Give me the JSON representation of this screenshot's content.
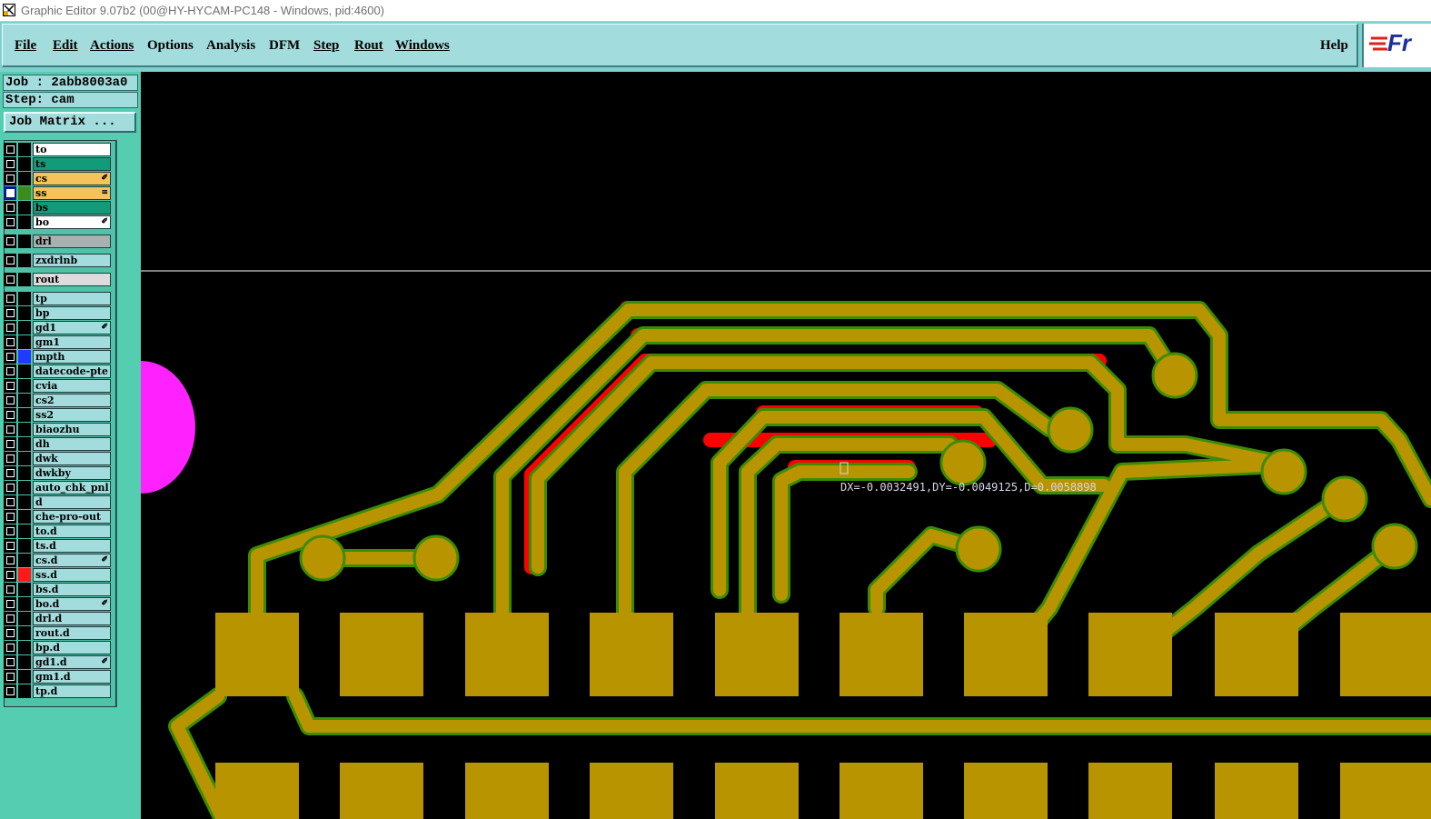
{
  "window": {
    "title": "Graphic Editor 9.07b2 (00@HY-HYCAM-PC148 - Windows, pid:4600)",
    "icon": "graphic-editor-icon"
  },
  "menu": {
    "file": "File",
    "edit": "Edit",
    "actions": "Actions",
    "options": "Options",
    "analysis": "Analysis",
    "dfm": "DFM",
    "step": "Step",
    "rout": "Rout",
    "windows": "Windows",
    "help": "Help",
    "logo": "Fr"
  },
  "panel": {
    "job_line": "Job : 2abb8003a0",
    "step_line": "Step: cam",
    "job_matrix_label": "Job Matrix ..."
  },
  "layers": [
    {
      "name": "to",
      "bg": "#ffffff",
      "mark": ""
    },
    {
      "name": "ts",
      "bg": "#139b79",
      "mark": ""
    },
    {
      "name": "cs",
      "bg": "#f6c25c",
      "mark": "✐"
    },
    {
      "name": "ss",
      "bg": "#f6c25c",
      "mark": "≡",
      "selected": true,
      "indicator": "#3b8c1a"
    },
    {
      "name": "bs",
      "bg": "#139b79",
      "mark": ""
    },
    {
      "name": "bo",
      "bg": "#ffffff",
      "mark": "✐"
    },
    {
      "name": "drl",
      "bg": "#a8b0b0",
      "mark": "",
      "gap": true
    },
    {
      "name": "zxdrlnb",
      "bg": "#a2dcdc",
      "mark": "",
      "gap": true
    },
    {
      "name": "rout",
      "bg": "#dcdcdc",
      "mark": "",
      "gap": true
    },
    {
      "name": "tp",
      "bg": "#a2dcdc",
      "mark": "",
      "gap": true
    },
    {
      "name": "bp",
      "bg": "#a2dcdc",
      "mark": ""
    },
    {
      "name": "gd1",
      "bg": "#a2dcdc",
      "mark": "✐"
    },
    {
      "name": "gm1",
      "bg": "#a2dcdc",
      "mark": ""
    },
    {
      "name": "mpth",
      "bg": "#a2dcdc",
      "mark": "",
      "indicator": "#1e3cff"
    },
    {
      "name": "datecode-pte",
      "bg": "#a2dcdc",
      "mark": ""
    },
    {
      "name": "cvia",
      "bg": "#a2dcdc",
      "mark": ""
    },
    {
      "name": "cs2",
      "bg": "#a2dcdc",
      "mark": ""
    },
    {
      "name": "ss2",
      "bg": "#a2dcdc",
      "mark": ""
    },
    {
      "name": "biaozhu",
      "bg": "#a2dcdc",
      "mark": ""
    },
    {
      "name": "dh",
      "bg": "#a2dcdc",
      "mark": ""
    },
    {
      "name": "dwk",
      "bg": "#a2dcdc",
      "mark": ""
    },
    {
      "name": "dwkby",
      "bg": "#a2dcdc",
      "mark": ""
    },
    {
      "name": "auto_chk_pnl",
      "bg": "#a2dcdc",
      "mark": ""
    },
    {
      "name": "d",
      "bg": "#a2dcdc",
      "mark": ""
    },
    {
      "name": "che-pro-out",
      "bg": "#a2dcdc",
      "mark": ""
    },
    {
      "name": "to.d",
      "bg": "#a2dcdc",
      "mark": ""
    },
    {
      "name": "ts.d",
      "bg": "#a2dcdc",
      "mark": ""
    },
    {
      "name": "cs.d",
      "bg": "#a2dcdc",
      "mark": "✐"
    },
    {
      "name": "ss.d",
      "bg": "#a2dcdc",
      "mark": "",
      "indicator": "#ff1a1a"
    },
    {
      "name": "bs.d",
      "bg": "#a2dcdc",
      "mark": ""
    },
    {
      "name": "bo.d",
      "bg": "#a2dcdc",
      "mark": "✐"
    },
    {
      "name": "drl.d",
      "bg": "#a2dcdc",
      "mark": ""
    },
    {
      "name": "rout.d",
      "bg": "#a2dcdc",
      "mark": ""
    },
    {
      "name": "bp.d",
      "bg": "#a2dcdc",
      "mark": ""
    },
    {
      "name": "gd1.d",
      "bg": "#a2dcdc",
      "mark": "✐"
    },
    {
      "name": "gm1.d",
      "bg": "#a2dcdc",
      "mark": ""
    },
    {
      "name": "tp.d",
      "bg": "#a2dcdc",
      "mark": ""
    }
  ],
  "canvas": {
    "measurement": "DX=-0.0032491,DY=-0.0049125,D=0.0058898",
    "colors": {
      "copper": "#b89400",
      "edge": "#3c8c00",
      "highlight": "#ff0000",
      "profile": "#ff22ff",
      "background": "#000000"
    }
  }
}
